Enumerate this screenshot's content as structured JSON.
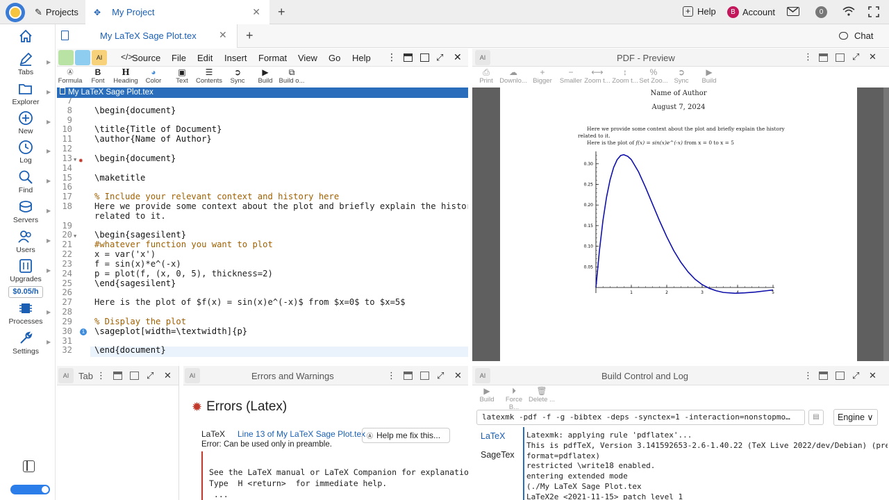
{
  "topbar": {
    "projects_label": "Projects",
    "project_tab_label": "My Project",
    "help_label": "Help",
    "account_label": "Account",
    "account_initial": "B",
    "notification_count": "0"
  },
  "rail": {
    "items": [
      {
        "label": "Tabs",
        "icon": "home-icon"
      },
      {
        "label": "Explorer",
        "icon": "folder-icon"
      },
      {
        "label": "New",
        "icon": "plus-circle-icon"
      },
      {
        "label": "Log",
        "icon": "history-icon"
      },
      {
        "label": "Find",
        "icon": "search-icon"
      },
      {
        "label": "Servers",
        "icon": "server-icon"
      },
      {
        "label": "Users",
        "icon": "users-icon"
      },
      {
        "label": "Upgrades",
        "icon": "sliders-icon"
      },
      {
        "label": "Processes",
        "icon": "cpu-icon"
      },
      {
        "label": "Settings",
        "icon": "wrench-icon"
      }
    ],
    "price_badge": "$0.05/h"
  },
  "file_tab": {
    "name": "My LaTeX Sage Plot.tex",
    "chat_label": "Chat"
  },
  "editor": {
    "menu": [
      "Source",
      "File",
      "Edit",
      "Insert",
      "Format",
      "View",
      "Go",
      "Help"
    ],
    "toolbar": [
      "Formula",
      "Font",
      "Heading",
      "Color",
      "Text",
      "Contents",
      "Sync",
      "Build",
      "Build o..."
    ],
    "filename_bar": "My LaTeX Sage Plot.tex",
    "lines": [
      {
        "n": "7",
        "t": ""
      },
      {
        "n": "8",
        "t": "\\begin{document}"
      },
      {
        "n": "9",
        "t": ""
      },
      {
        "n": "10",
        "t": "\\title{Title of Document}"
      },
      {
        "n": "11",
        "t": "\\author{Name of Author}"
      },
      {
        "n": "12",
        "t": ""
      },
      {
        "n": "13",
        "t": "\\begin{document}"
      },
      {
        "n": "14",
        "t": ""
      },
      {
        "n": "15",
        "t": "\\maketitle"
      },
      {
        "n": "16",
        "t": ""
      },
      {
        "n": "17",
        "t": "% Include your relevant context and history here"
      },
      {
        "n": "18",
        "t": "Here we provide some context about the plot and briefly explain the history"
      },
      {
        "n": "",
        "t": "related to it."
      },
      {
        "n": "19",
        "t": ""
      },
      {
        "n": "20",
        "t": "\\begin{sagesilent}"
      },
      {
        "n": "21",
        "t": "#whatever function you want to plot"
      },
      {
        "n": "22",
        "t": "x = var('x')"
      },
      {
        "n": "23",
        "t": "f = sin(x)*e^(-x)"
      },
      {
        "n": "24",
        "t": "p = plot(f, (x, 0, 5), thickness=2)"
      },
      {
        "n": "25",
        "t": "\\end{sagesilent}"
      },
      {
        "n": "26",
        "t": ""
      },
      {
        "n": "27",
        "t": "Here is the plot of $f(x) = sin(x)e^(-x)$ from $x=0$ to $x=5$"
      },
      {
        "n": "28",
        "t": ""
      },
      {
        "n": "29",
        "t": "% Display the plot"
      },
      {
        "n": "30",
        "t": "\\sageplot[width=\\textwidth]{p}"
      },
      {
        "n": "31",
        "t": ""
      },
      {
        "n": "32",
        "t": "\\end{document}"
      }
    ]
  },
  "pdf": {
    "title": "PDF - Preview",
    "toolbar": [
      "Print",
      "Downlo...",
      "Bigger",
      "Smaller",
      "Zoom t...",
      "Zoom t...",
      "Set Zoo...",
      "Sync",
      "Build"
    ],
    "author": "Name of Author",
    "date": "August 7, 2024",
    "para1": "Here we provide some context about the plot and briefly explain the history",
    "para1b": "related to it.",
    "para2_prefix": "Here is the plot of ",
    "para2_math": "f(x) = sin(x)e^(-x)",
    "para2_suffix": " from x = 0 to x = 5"
  },
  "chart_data": {
    "type": "line",
    "title": "",
    "xlabel": "",
    "ylabel": "",
    "xlim": [
      0,
      5
    ],
    "ylim": [
      -0.02,
      0.33
    ],
    "x_ticks": [
      "1",
      "2",
      "3",
      "4",
      "5"
    ],
    "y_ticks": [
      "0.05",
      "0.10",
      "0.15",
      "0.20",
      "0.25",
      "0.30"
    ],
    "series": [
      {
        "function": "sin(x)*e^(-x)",
        "color": "#1010aa",
        "x": [
          0,
          0.1,
          0.2,
          0.3,
          0.4,
          0.5,
          0.6,
          0.7,
          0.785,
          0.9,
          1.0,
          1.2,
          1.4,
          1.6,
          1.8,
          2.0,
          2.2,
          2.4,
          2.6,
          2.8,
          3.0,
          3.2,
          3.4,
          3.6,
          3.93,
          4.2,
          4.5,
          4.8,
          5.0
        ],
        "y": [
          0,
          0.09,
          0.163,
          0.219,
          0.261,
          0.291,
          0.31,
          0.32,
          0.322,
          0.318,
          0.31,
          0.281,
          0.243,
          0.202,
          0.161,
          0.123,
          0.089,
          0.061,
          0.038,
          0.02,
          0.007,
          -0.002,
          -0.008,
          -0.012,
          -0.014,
          -0.013,
          -0.011,
          -0.008,
          -0.006
        ]
      }
    ]
  },
  "errors": {
    "tab_short": "Tab",
    "title": "Errors and Warnings",
    "heading": "Errors (Latex)",
    "item_type": "LaTeX",
    "item_link": "Line 13 of My LaTeX Sage Plot.tex",
    "help_button": "Help me fix this...",
    "message": "Error: Can be used only in preamble.",
    "detail1": "See the LaTeX manual or LaTeX Companion for explanatio",
    "detail2": "Type  H <return>  for immediate help.",
    "detail3": " ..."
  },
  "build": {
    "title": "Build Control and Log",
    "toolbar": [
      "Build",
      "Force B...",
      "Delete ..."
    ],
    "command": "latexmk -pdf -f -g -bibtex -deps -synctex=1 -interaction=nonstopmode 'My LaTeX Sage Plot.tex'",
    "engine_label": "Engine",
    "tabs": [
      "LaTeX",
      "SageTex"
    ],
    "log": [
      "Latexmk: applying rule 'pdflatex'...",
      "This is pdfTeX, Version 3.141592653-2.6-1.40.22 (TeX Live 2022/dev/Debian) (preloaded",
      "format=pdflatex)",
      "restricted \\write18 enabled.",
      "entering extended mode",
      "(./My LaTeX Sage Plot.tex",
      "LaTeX2e <2021-11-15> patch level 1"
    ]
  }
}
